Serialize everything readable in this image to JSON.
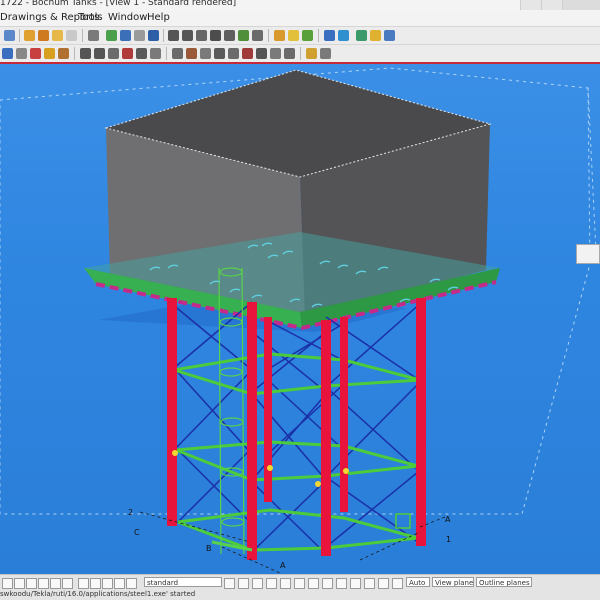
{
  "window": {
    "title": "1722 - Bochum Tanks - [View 1 - Standard rendered]"
  },
  "menu": {
    "items": [
      "Drawings & Reports",
      "Tools",
      "Window",
      "Help"
    ]
  },
  "viewport": {
    "grid_labels": [
      "2",
      "C",
      "B",
      "A",
      "A",
      "1"
    ]
  },
  "statusbar": {
    "view_name": "standard",
    "snap_mode": "Auto",
    "view_plane": "View plane",
    "outline_planes": "Outline planes",
    "message": "swkoodu/Tekla/ruti/16.0/applications/steel1.exe' started"
  },
  "colors": {
    "accent": "#c42a3a",
    "viewport_bg": "#2f86e0",
    "column": "#e8143c",
    "brace": "#1b2fa8",
    "beam": "#4ccc3a"
  }
}
